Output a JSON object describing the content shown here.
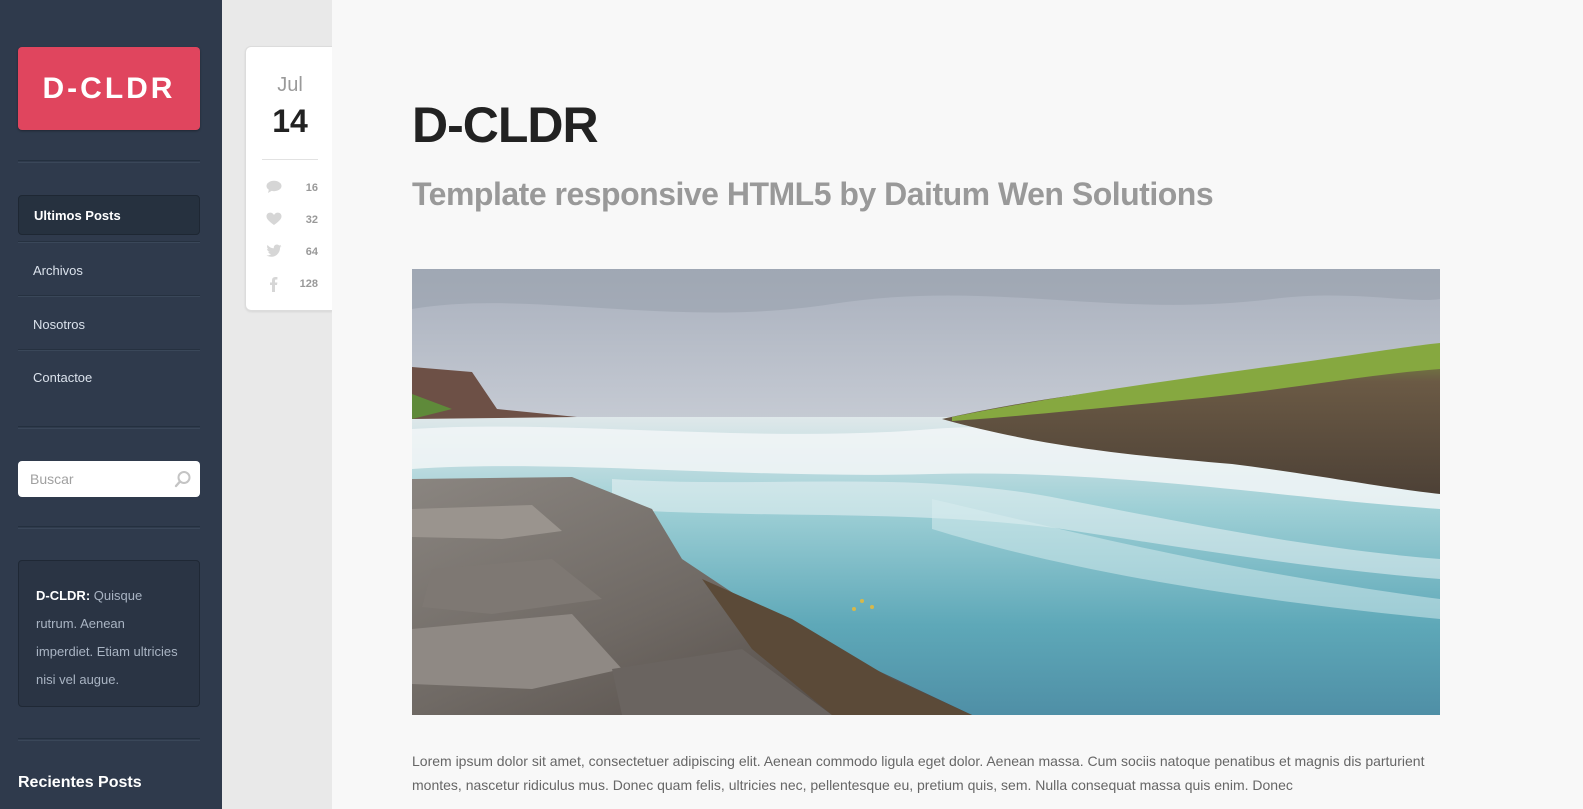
{
  "sidebar": {
    "logo": "D-CLDR",
    "nav": [
      {
        "label": "Ultimos Posts",
        "active": true
      },
      {
        "label": "Archivos",
        "active": false
      },
      {
        "label": "Nosotros",
        "active": false
      },
      {
        "label": "Contactoe",
        "active": false
      }
    ],
    "search": {
      "placeholder": "Buscar",
      "icon": "search-icon"
    },
    "about": {
      "brand": "D-CLDR:",
      "text": " Quisque rutrum. Aenean imperdiet. Etiam ultricies nisi vel augue."
    },
    "recent_title": "Recientes Posts"
  },
  "post": {
    "date": {
      "month": "Jul",
      "day": "14"
    },
    "stats": {
      "comments": "16",
      "likes": "32",
      "tweets": "64",
      "facebook": "128"
    },
    "title": "D-CLDR",
    "subtitle": "Template responsive HTML5 by Daitum Wen Solutions",
    "body": "Lorem ipsum dolor sit amet, consectetuer adipiscing elit. Aenean commodo ligula eget dolor. Aenean massa. Cum sociis natoque penatibus et magnis dis parturient montes, nascetur ridiculus mus. Donec quam felis, ultricies nec, pellentesque eu, pretium quis, sem. Nulla consequat massa quis enim. Donec"
  },
  "colors": {
    "accent": "#e0455e",
    "sidebar": "#2f3a4c"
  }
}
